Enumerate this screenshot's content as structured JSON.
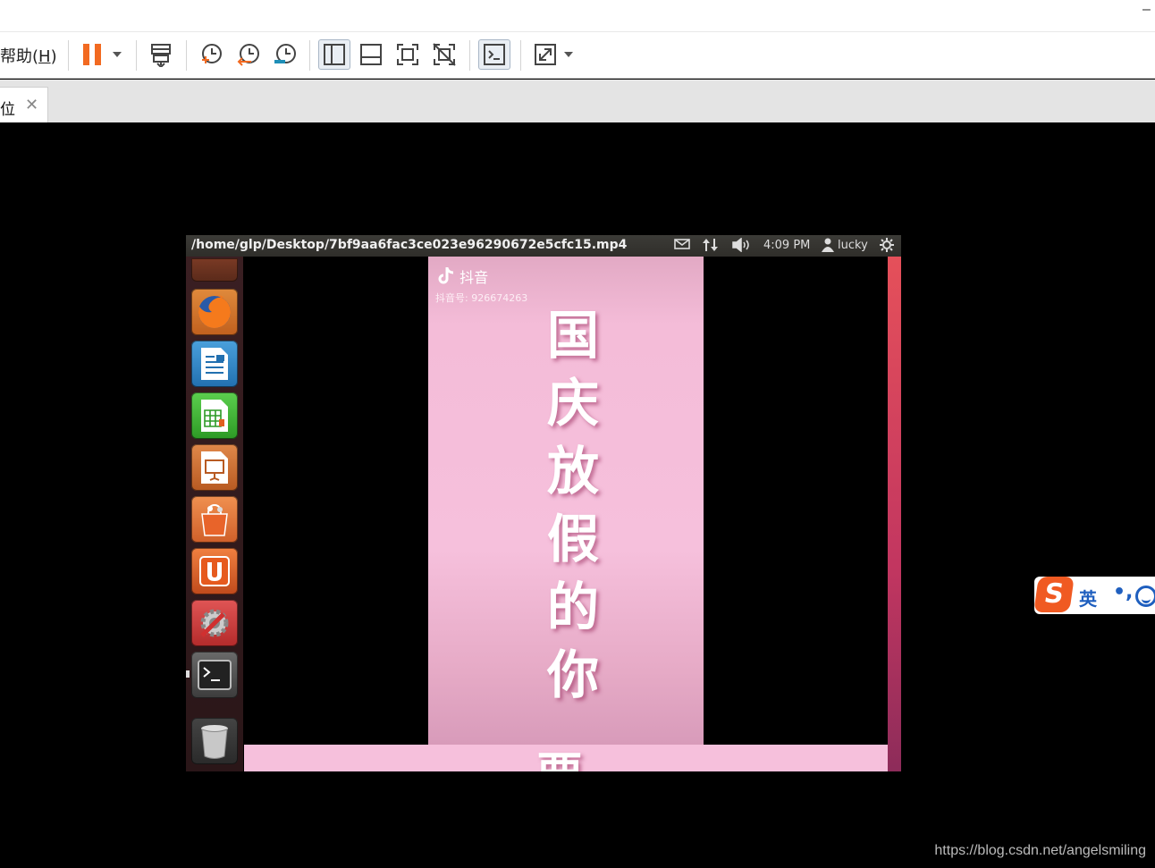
{
  "host": {
    "menu": {
      "help_label": "帮助(",
      "help_key": "H",
      "help_close": ")"
    },
    "window_controls": {
      "minimize": "–"
    },
    "toolbar": {
      "buttons": [
        "pause-icon",
        "send-ctrl-alt-del-icon",
        "snapshot-take-icon",
        "snapshot-revert-icon",
        "snapshot-manager-icon",
        "view-sidebar-icon",
        "view-thumbnail-icon",
        "fullscreen-icon",
        "unity-icon",
        "console-icon",
        "stretch-icon"
      ],
      "pause_color": "#f26a21"
    },
    "tab": {
      "label": "位",
      "close": "✕"
    }
  },
  "guest": {
    "panel": {
      "title": "/home/glp/Desktop/7bf9aa6fac3ce023e96290672e5cfc15.mp4",
      "time": "4:09 PM",
      "user": "lucky",
      "icons": [
        "mail-icon",
        "network-icon",
        "volume-icon",
        "user-icon",
        "gear-icon"
      ]
    },
    "launcher": {
      "items": [
        "dash-icon",
        "firefox-icon",
        "writer-icon",
        "calc-icon",
        "impress-icon",
        "software-center-icon",
        "ubuntu-one-icon",
        "system-settings-icon",
        "terminal-icon",
        "trash-icon"
      ]
    },
    "video": {
      "app_name": "抖音",
      "account_id": "抖音号: 926674263",
      "caption_chars": [
        "国",
        "庆",
        "放",
        "假",
        "的",
        "你"
      ],
      "bottom_char": "要"
    }
  },
  "ime": {
    "logo": "S",
    "lang": "英",
    "punct": "•,",
    "emoji": "emoji-icon",
    "brand_color": "#f05a22"
  },
  "watermark": "https://blog.csdn.net/angelsmiling"
}
